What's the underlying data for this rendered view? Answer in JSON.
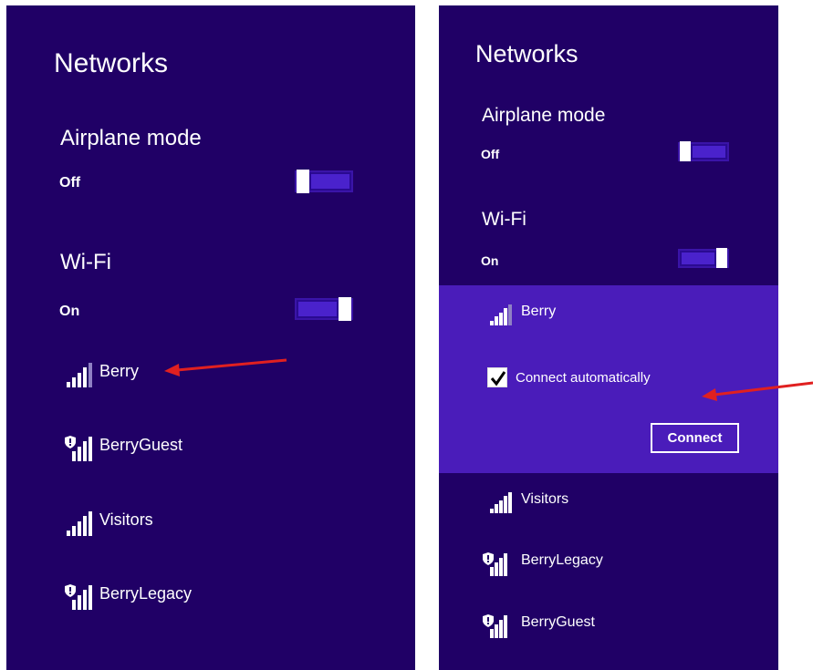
{
  "left_panel": {
    "title": "Networks",
    "airplane": {
      "label": "Airplane mode",
      "state": "Off",
      "on": false
    },
    "wifi": {
      "label": "Wi-Fi",
      "state": "On",
      "on": true
    },
    "networks": [
      {
        "name": "Berry",
        "secured_warning": false,
        "bars": 4
      },
      {
        "name": "BerryGuest",
        "secured_warning": true,
        "bars": 4
      },
      {
        "name": "Visitors",
        "secured_warning": false,
        "bars": 4
      },
      {
        "name": "BerryLegacy",
        "secured_warning": true,
        "bars": 4
      }
    ]
  },
  "right_panel": {
    "title": "Networks",
    "airplane": {
      "label": "Airplane mode",
      "state": "Off",
      "on": false
    },
    "wifi": {
      "label": "Wi-Fi",
      "state": "On",
      "on": true
    },
    "selected_network": {
      "name": "Berry",
      "connect_automatically_label": "Connect automatically",
      "connect_automatically_checked": true,
      "connect_button": "Connect"
    },
    "networks": [
      {
        "name": "Visitors",
        "secured_warning": false,
        "bars": 4
      },
      {
        "name": "BerryLegacy",
        "secured_warning": true,
        "bars": 4
      },
      {
        "name": "BerryGuest",
        "secured_warning": true,
        "bars": 4
      }
    ]
  },
  "colors": {
    "panel_bg": "#200066",
    "selected_bg": "#4a1cba",
    "toggle_fill": "#4a22cc",
    "annotation_arrow": "#e02020"
  }
}
